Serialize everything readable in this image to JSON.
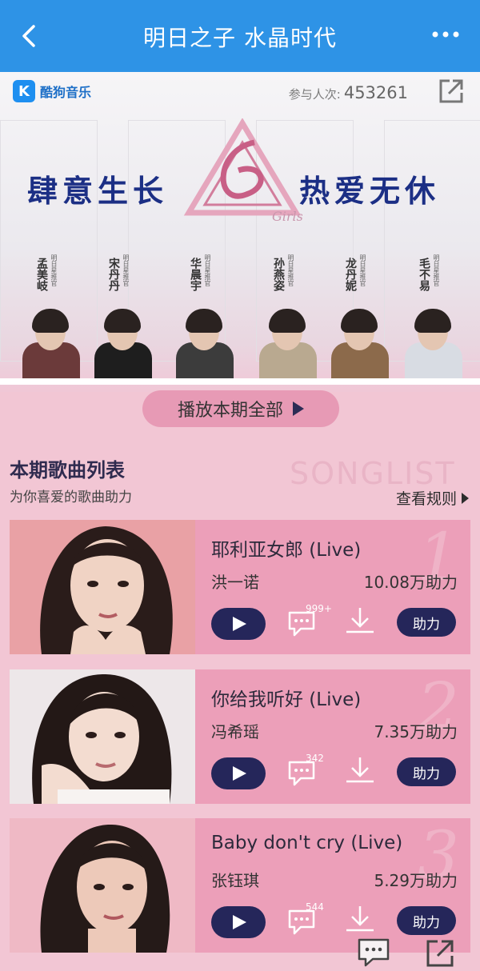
{
  "nav": {
    "title": "明日之子 水晶时代"
  },
  "banner": {
    "logo_text": "酷狗音乐",
    "participants_label": "参与人次:",
    "participants_count": "453261",
    "slogan_left": "肆意生长",
    "slogan_right": "热爱无休",
    "emblem_caption": "Girls",
    "judges": [
      {
        "name": "孟美岐",
        "role": "明日星推官",
        "body_color": "#6b3a3a"
      },
      {
        "name": "宋丹丹",
        "role": "明日星推官",
        "body_color": "#1e1e1e"
      },
      {
        "name": "华晨宇",
        "role": "明日星推官",
        "body_color": "#3c3c3c"
      },
      {
        "name": "孙燕姿",
        "role": "明日星推官",
        "body_color": "#b9a990"
      },
      {
        "name": "龙丹妮",
        "role": "明日星推官",
        "body_color": "#8c6a4b"
      },
      {
        "name": "毛不易",
        "role": "明日星推官",
        "body_color": "#d8dce3"
      }
    ]
  },
  "play_all_label": "播放本期全部",
  "songlist": {
    "title": "本期歌曲列表",
    "subtitle": "为你喜爱的歌曲助力",
    "watermark": "SONGLIST",
    "rules_label": "查看规则",
    "help_label": "助力",
    "items": [
      {
        "rank": "1",
        "song": "耶利亚女郎 (Live)",
        "artist": "洪一诺",
        "votes": "10.08万助力",
        "comments": "999+"
      },
      {
        "rank": "2",
        "song": "你给我听好 (Live)",
        "artist": "冯希瑶",
        "votes": "7.35万助力",
        "comments": "342"
      },
      {
        "rank": "3",
        "song": "Baby don't cry (Live)",
        "artist": "张钰琪",
        "votes": "5.29万助力",
        "comments": "544"
      }
    ]
  },
  "colors": {
    "nav_bg": "#2e93e6",
    "card_bg": "#ec9fb9",
    "button_dark": "#25265a",
    "slogan": "#1c2f85"
  }
}
